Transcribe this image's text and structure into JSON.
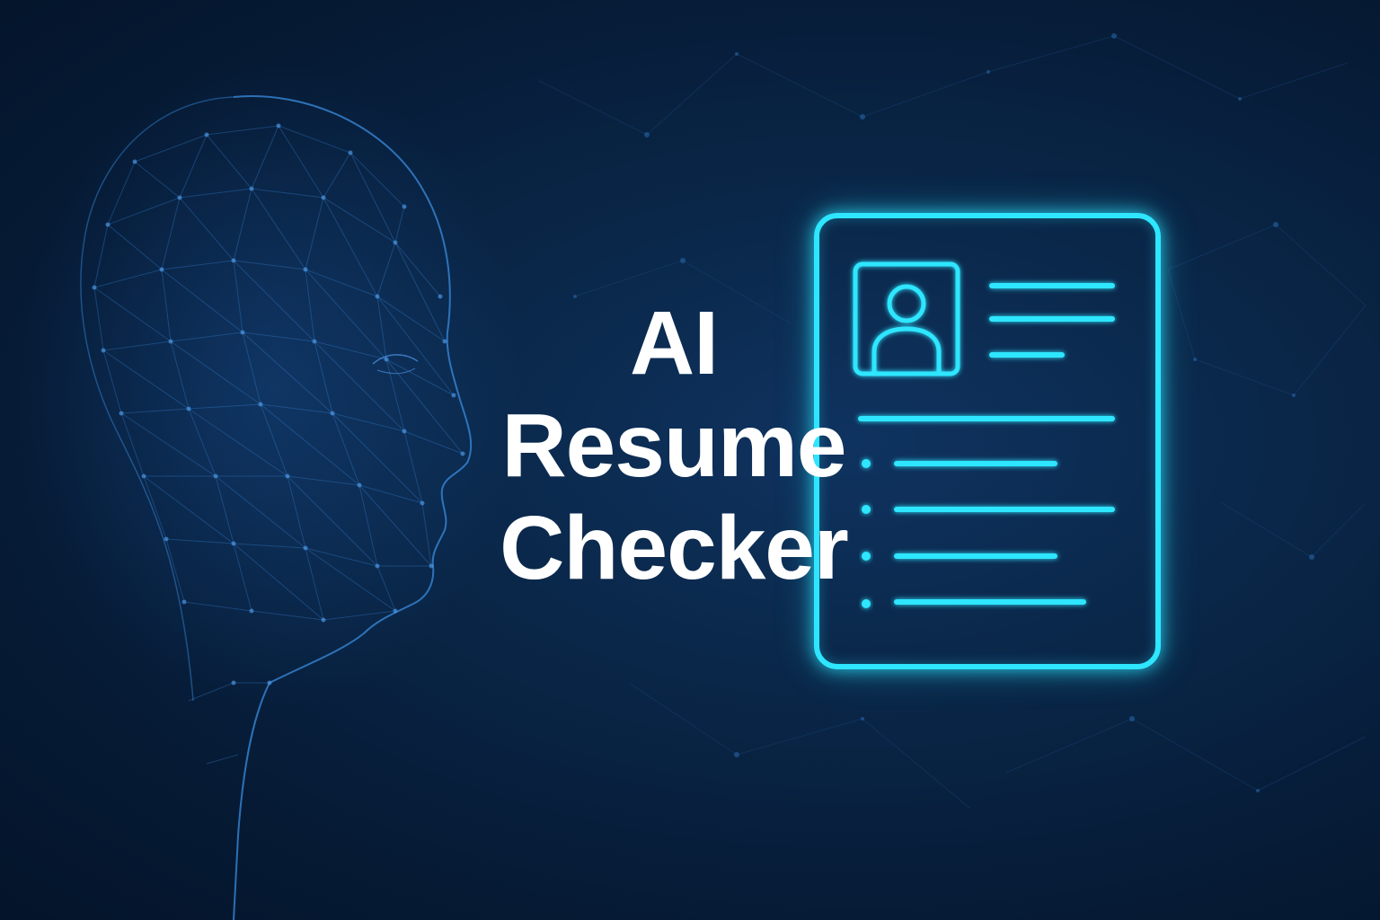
{
  "headline": {
    "line1": "AI",
    "line2": "Resume",
    "line3": "Checker"
  },
  "icons": {
    "head": "wireframe-head-icon",
    "document": "resume-document-icon",
    "avatar": "user-avatar-icon"
  },
  "colors": {
    "background": "#061a33",
    "neon": "#2ee6ff",
    "mesh": "#2f7fd6",
    "text": "#ffffff"
  }
}
